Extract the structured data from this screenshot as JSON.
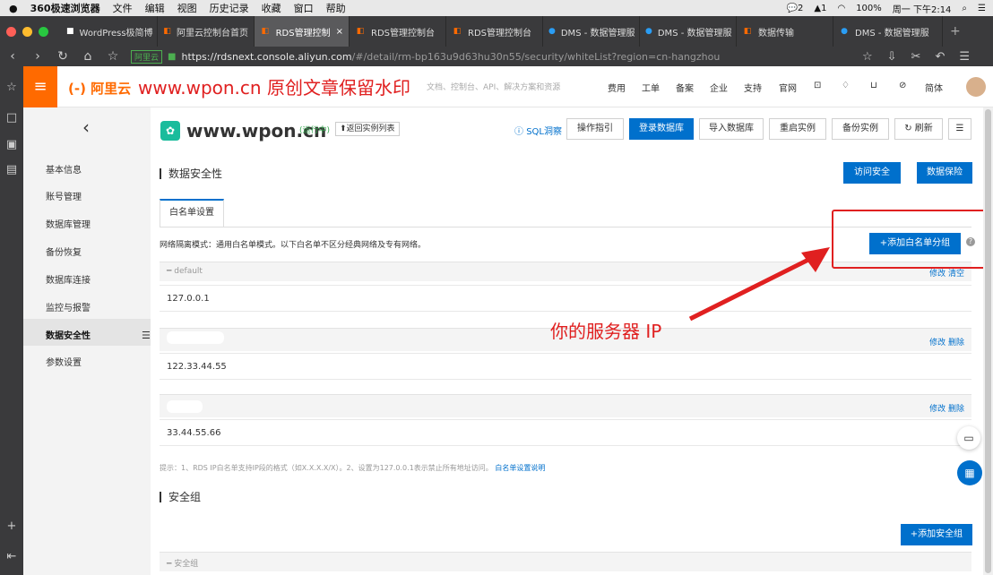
{
  "mac_menu": {
    "apple": "",
    "app": "360极速浏览器",
    "items": [
      "文件",
      "编辑",
      "视图",
      "历史记录",
      "收藏",
      "窗口",
      "帮助"
    ],
    "status": {
      "wechat": "2",
      "qq": "1",
      "battery": "100%",
      "clock": "周一 下午2:14"
    }
  },
  "tabs": [
    {
      "label": "WordPress极简博",
      "icon": "wordpress-icon",
      "active": false
    },
    {
      "label": "阿里云控制台首页",
      "icon": "aliyun-icon",
      "active": false
    },
    {
      "label": "RDS管理控制",
      "icon": "aliyun-icon",
      "active": true
    },
    {
      "label": "RDS管理控制台",
      "icon": "aliyun-icon",
      "active": false
    },
    {
      "label": "RDS管理控制台",
      "icon": "aliyun-icon",
      "active": false
    },
    {
      "label": "DMS - 数据管理服",
      "icon": "dms-icon",
      "active": false
    },
    {
      "label": "DMS - 数据管理服",
      "icon": "dms-icon",
      "active": false
    },
    {
      "label": "数据传输",
      "icon": "aliyun-icon",
      "active": false
    },
    {
      "label": "DMS - 数据管理服",
      "icon": "dms-icon",
      "active": false
    }
  ],
  "url": {
    "site_badge": "阿里云",
    "host": "https://rdsnext.console.aliyun.com",
    "path": "/#/detail/rm-bp163u9d63hu30n55/security/whiteList?region=cn-hangzhou"
  },
  "topnav": {
    "logo": "(-) 阿里云",
    "watermark": "www.wpon.cn 原创文章保留水印",
    "search_placeholder": "文档、控制台、API、解决方案和资源",
    "items": [
      "费用",
      "工单",
      "备案",
      "企业",
      "支持",
      "官网"
    ],
    "lang": "简体"
  },
  "sidebar": {
    "back": "‹",
    "items": [
      {
        "label": "基本信息",
        "active": false
      },
      {
        "label": "账号管理",
        "active": false
      },
      {
        "label": "数据库管理",
        "active": false
      },
      {
        "label": "备份恢复",
        "active": false
      },
      {
        "label": "数据库连接",
        "active": false
      },
      {
        "label": "监控与报警",
        "active": false
      },
      {
        "label": "数据安全性",
        "active": true
      },
      {
        "label": "参数设置",
        "active": false
      }
    ]
  },
  "instance": {
    "name": "www.wpon.cn",
    "status": "(运行中)",
    "back_list": "⬆返回实例列表"
  },
  "toolbar": {
    "sql": "SQL洞察",
    "guide": "操作指引",
    "login": "登录数据库",
    "import": "导入数据库",
    "restart": "重启实例",
    "backup": "备份实例",
    "refresh": "刷新"
  },
  "security": {
    "title": "数据安全性",
    "access_btn": "访问安全",
    "protect_btn": "数据保险",
    "tab": "白名单设置",
    "mode_text": "网络隔离模式：通用白名单模式。以下白名单不区分经典网络及专有网络。",
    "add_group": "+添加白名单分组",
    "groups": [
      {
        "name": "default",
        "ip": "127.0.0.1",
        "actions": "修改 清空"
      },
      {
        "name": "",
        "ip": "122.33.44.55",
        "actions": "修改 删除"
      },
      {
        "name": "",
        "ip": "33.44.55.66",
        "actions": "修改 删除"
      }
    ],
    "tip": "提示：1、RDS IP白名单支持IP段的格式（如X.X.X.X/X）。2、设置为127.0.0.1表示禁止所有地址访问。",
    "tip_link": "白名单设置说明",
    "sg_title": "安全组",
    "add_sg": "+添加安全组",
    "sg_head": "安全组"
  },
  "annotation": {
    "text": "你的服务器 IP",
    "color": "#e02020"
  }
}
